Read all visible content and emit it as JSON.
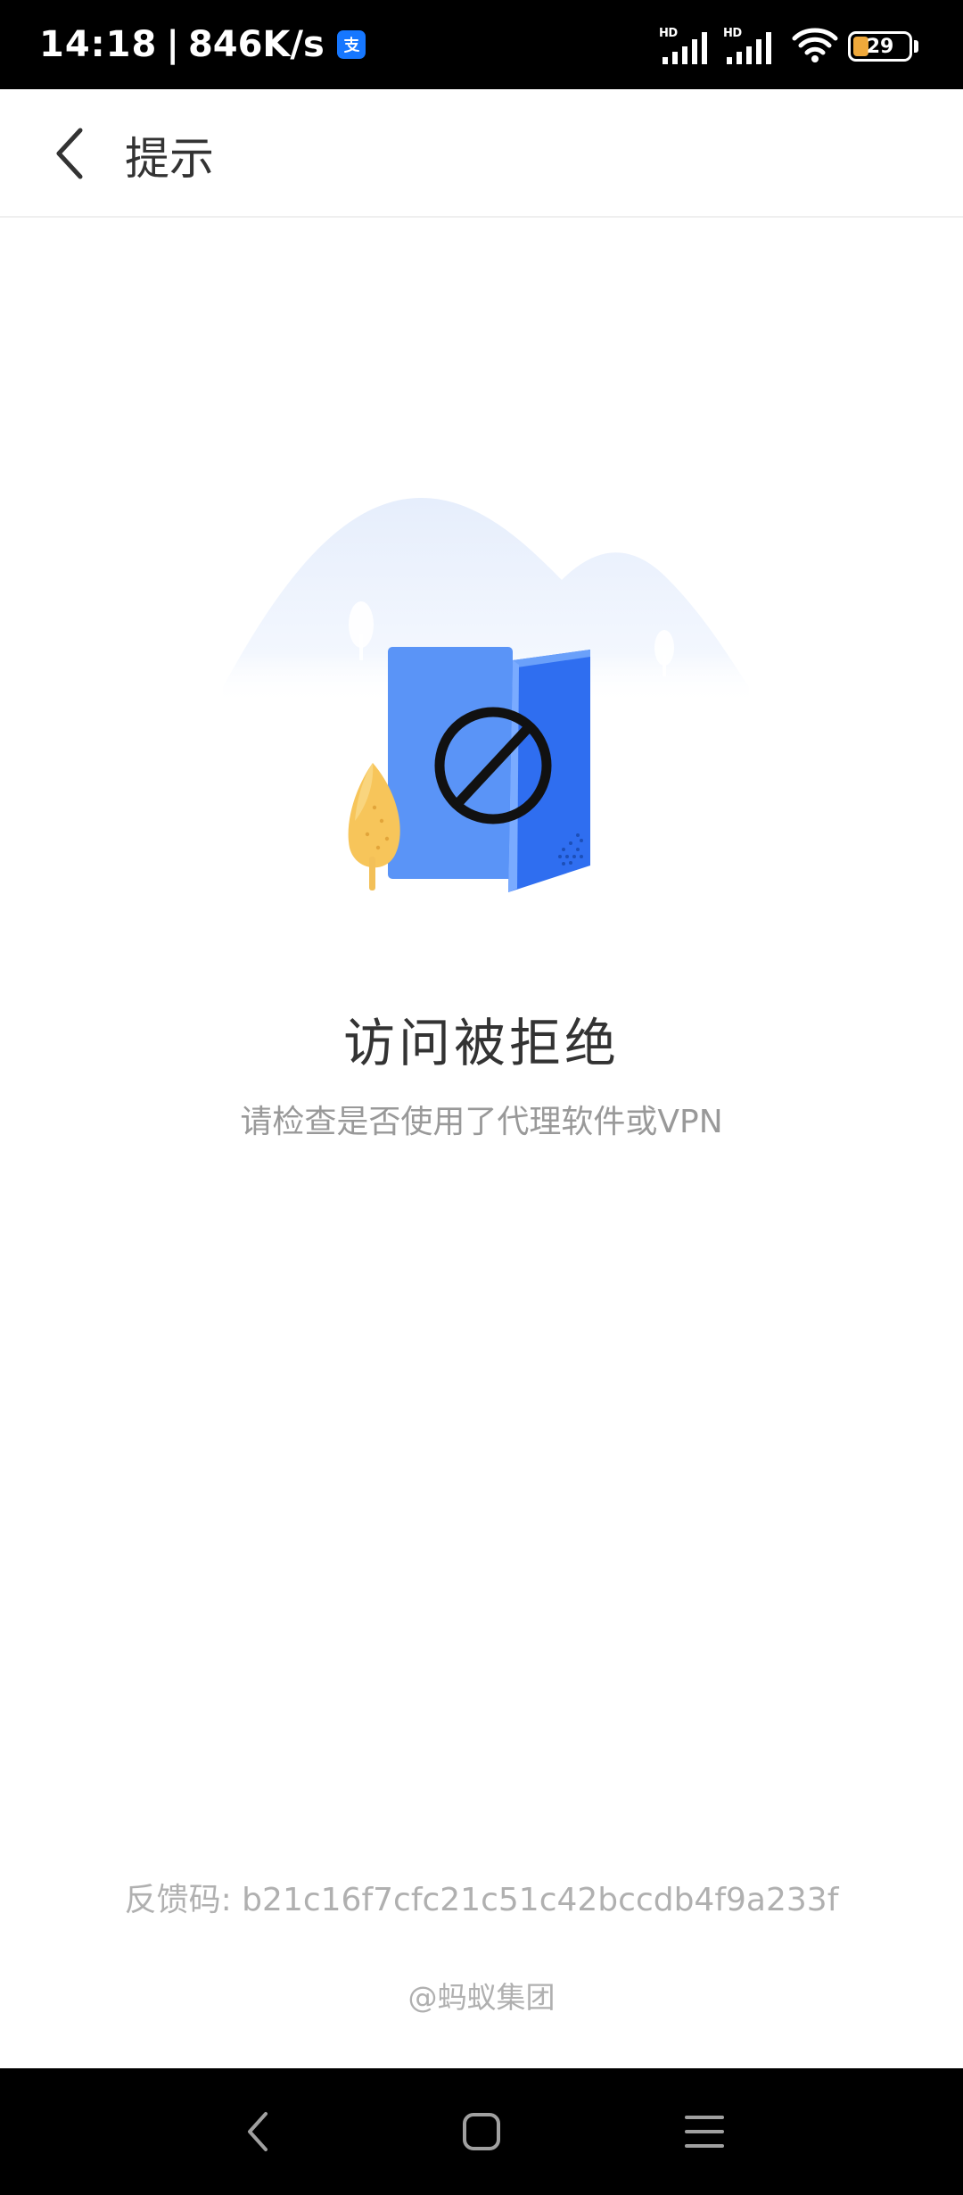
{
  "status_bar": {
    "time": "14:18",
    "separator": "|",
    "speed": "846K/s",
    "app_icon": "alipay-icon",
    "signal_label_1": "HD",
    "signal_label_2": "HD",
    "battery_level": "29",
    "battery_percent": 29
  },
  "header": {
    "title": "提示",
    "back_icon": "chevron-left-icon"
  },
  "main": {
    "title": "访问被拒绝",
    "subtitle": "请检查是否使用了代理软件或VPN",
    "illustration": "blocked-door-illustration"
  },
  "footer": {
    "feedback": "反馈码: b21c16f7cfc21c51c42bccdb4f9a233f",
    "brand": "@蚂蚁集团"
  },
  "nav_bar": {
    "back": "back-nav-icon",
    "home": "home-nav-icon",
    "menu": "menu-nav-icon"
  },
  "colors": {
    "accent_blue": "#4b8bf5",
    "door_blue": "#2f6ef0",
    "tree_yellow": "#f7c55a",
    "hill_blue": "#eaf1fd",
    "text_dark": "#333333",
    "text_gray": "#999999"
  }
}
